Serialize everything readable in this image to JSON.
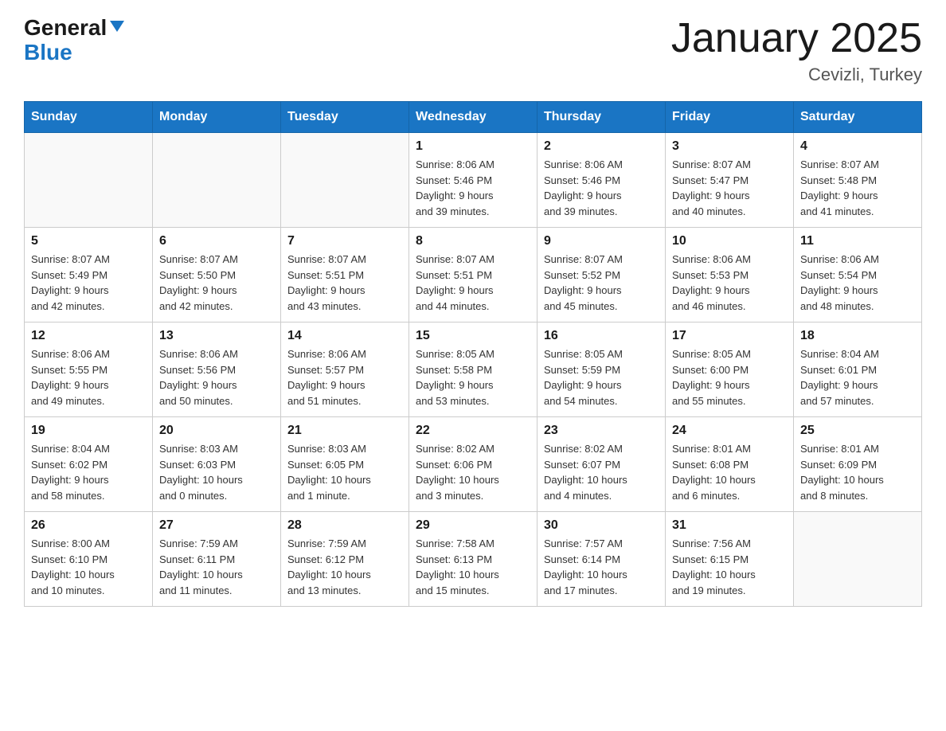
{
  "logo": {
    "text1": "General",
    "text2": "Blue"
  },
  "title": "January 2025",
  "subtitle": "Cevizli, Turkey",
  "days_of_week": [
    "Sunday",
    "Monday",
    "Tuesday",
    "Wednesday",
    "Thursday",
    "Friday",
    "Saturday"
  ],
  "weeks": [
    [
      {
        "day": "",
        "info": ""
      },
      {
        "day": "",
        "info": ""
      },
      {
        "day": "",
        "info": ""
      },
      {
        "day": "1",
        "info": "Sunrise: 8:06 AM\nSunset: 5:46 PM\nDaylight: 9 hours\nand 39 minutes."
      },
      {
        "day": "2",
        "info": "Sunrise: 8:06 AM\nSunset: 5:46 PM\nDaylight: 9 hours\nand 39 minutes."
      },
      {
        "day": "3",
        "info": "Sunrise: 8:07 AM\nSunset: 5:47 PM\nDaylight: 9 hours\nand 40 minutes."
      },
      {
        "day": "4",
        "info": "Sunrise: 8:07 AM\nSunset: 5:48 PM\nDaylight: 9 hours\nand 41 minutes."
      }
    ],
    [
      {
        "day": "5",
        "info": "Sunrise: 8:07 AM\nSunset: 5:49 PM\nDaylight: 9 hours\nand 42 minutes."
      },
      {
        "day": "6",
        "info": "Sunrise: 8:07 AM\nSunset: 5:50 PM\nDaylight: 9 hours\nand 42 minutes."
      },
      {
        "day": "7",
        "info": "Sunrise: 8:07 AM\nSunset: 5:51 PM\nDaylight: 9 hours\nand 43 minutes."
      },
      {
        "day": "8",
        "info": "Sunrise: 8:07 AM\nSunset: 5:51 PM\nDaylight: 9 hours\nand 44 minutes."
      },
      {
        "day": "9",
        "info": "Sunrise: 8:07 AM\nSunset: 5:52 PM\nDaylight: 9 hours\nand 45 minutes."
      },
      {
        "day": "10",
        "info": "Sunrise: 8:06 AM\nSunset: 5:53 PM\nDaylight: 9 hours\nand 46 minutes."
      },
      {
        "day": "11",
        "info": "Sunrise: 8:06 AM\nSunset: 5:54 PM\nDaylight: 9 hours\nand 48 minutes."
      }
    ],
    [
      {
        "day": "12",
        "info": "Sunrise: 8:06 AM\nSunset: 5:55 PM\nDaylight: 9 hours\nand 49 minutes."
      },
      {
        "day": "13",
        "info": "Sunrise: 8:06 AM\nSunset: 5:56 PM\nDaylight: 9 hours\nand 50 minutes."
      },
      {
        "day": "14",
        "info": "Sunrise: 8:06 AM\nSunset: 5:57 PM\nDaylight: 9 hours\nand 51 minutes."
      },
      {
        "day": "15",
        "info": "Sunrise: 8:05 AM\nSunset: 5:58 PM\nDaylight: 9 hours\nand 53 minutes."
      },
      {
        "day": "16",
        "info": "Sunrise: 8:05 AM\nSunset: 5:59 PM\nDaylight: 9 hours\nand 54 minutes."
      },
      {
        "day": "17",
        "info": "Sunrise: 8:05 AM\nSunset: 6:00 PM\nDaylight: 9 hours\nand 55 minutes."
      },
      {
        "day": "18",
        "info": "Sunrise: 8:04 AM\nSunset: 6:01 PM\nDaylight: 9 hours\nand 57 minutes."
      }
    ],
    [
      {
        "day": "19",
        "info": "Sunrise: 8:04 AM\nSunset: 6:02 PM\nDaylight: 9 hours\nand 58 minutes."
      },
      {
        "day": "20",
        "info": "Sunrise: 8:03 AM\nSunset: 6:03 PM\nDaylight: 10 hours\nand 0 minutes."
      },
      {
        "day": "21",
        "info": "Sunrise: 8:03 AM\nSunset: 6:05 PM\nDaylight: 10 hours\nand 1 minute."
      },
      {
        "day": "22",
        "info": "Sunrise: 8:02 AM\nSunset: 6:06 PM\nDaylight: 10 hours\nand 3 minutes."
      },
      {
        "day": "23",
        "info": "Sunrise: 8:02 AM\nSunset: 6:07 PM\nDaylight: 10 hours\nand 4 minutes."
      },
      {
        "day": "24",
        "info": "Sunrise: 8:01 AM\nSunset: 6:08 PM\nDaylight: 10 hours\nand 6 minutes."
      },
      {
        "day": "25",
        "info": "Sunrise: 8:01 AM\nSunset: 6:09 PM\nDaylight: 10 hours\nand 8 minutes."
      }
    ],
    [
      {
        "day": "26",
        "info": "Sunrise: 8:00 AM\nSunset: 6:10 PM\nDaylight: 10 hours\nand 10 minutes."
      },
      {
        "day": "27",
        "info": "Sunrise: 7:59 AM\nSunset: 6:11 PM\nDaylight: 10 hours\nand 11 minutes."
      },
      {
        "day": "28",
        "info": "Sunrise: 7:59 AM\nSunset: 6:12 PM\nDaylight: 10 hours\nand 13 minutes."
      },
      {
        "day": "29",
        "info": "Sunrise: 7:58 AM\nSunset: 6:13 PM\nDaylight: 10 hours\nand 15 minutes."
      },
      {
        "day": "30",
        "info": "Sunrise: 7:57 AM\nSunset: 6:14 PM\nDaylight: 10 hours\nand 17 minutes."
      },
      {
        "day": "31",
        "info": "Sunrise: 7:56 AM\nSunset: 6:15 PM\nDaylight: 10 hours\nand 19 minutes."
      },
      {
        "day": "",
        "info": ""
      }
    ]
  ]
}
